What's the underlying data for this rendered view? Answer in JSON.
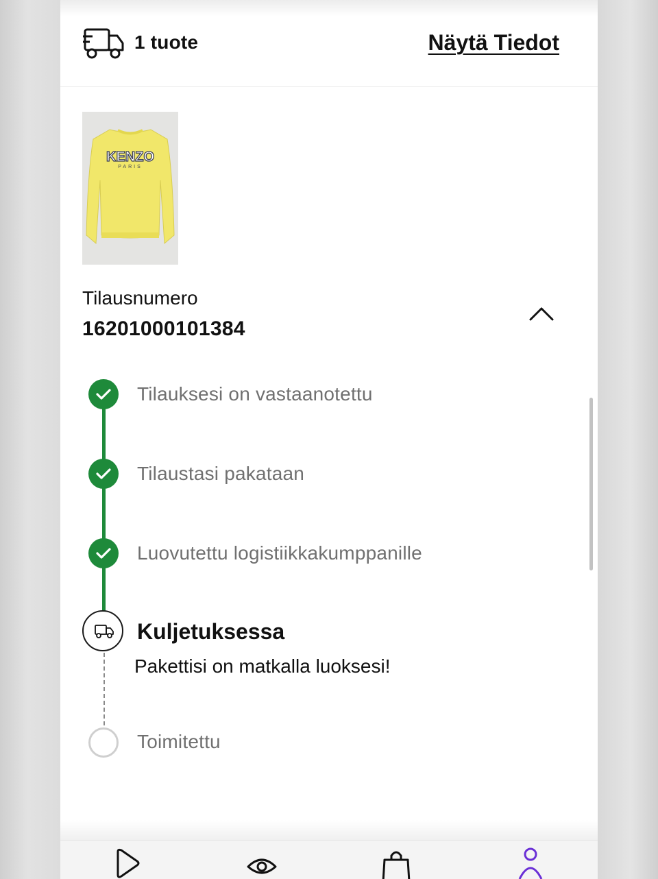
{
  "header": {
    "item_count": "1 tuote",
    "details_link": "Näytä Tiedot"
  },
  "product": {
    "image_icon": "product-sweater-image",
    "brand_print": "KENZO",
    "brand_sub": "PARIS"
  },
  "order": {
    "label": "Tilausnumero",
    "number": "16201000101384"
  },
  "timeline": {
    "steps": [
      {
        "label": "Tilauksesi on vastaanotettu",
        "status": "done"
      },
      {
        "label": "Tilaustasi pakataan",
        "status": "done"
      },
      {
        "label": "Luovutettu logistiikkakumppanille",
        "status": "done"
      },
      {
        "label": "Kuljetuksessa",
        "status": "current",
        "description": "Pakettisi on matkalla luoksesi!"
      },
      {
        "label": "Toimitettu",
        "status": "pending"
      }
    ]
  },
  "bottom_nav": {
    "items": [
      "play-icon",
      "eye-icon",
      "bag-icon",
      "profile-icon"
    ],
    "active_color": "#6a2fd6"
  },
  "colors": {
    "done_green": "#1e8a3a",
    "muted_text": "#707070",
    "pending_ring": "#cfcfcf"
  }
}
